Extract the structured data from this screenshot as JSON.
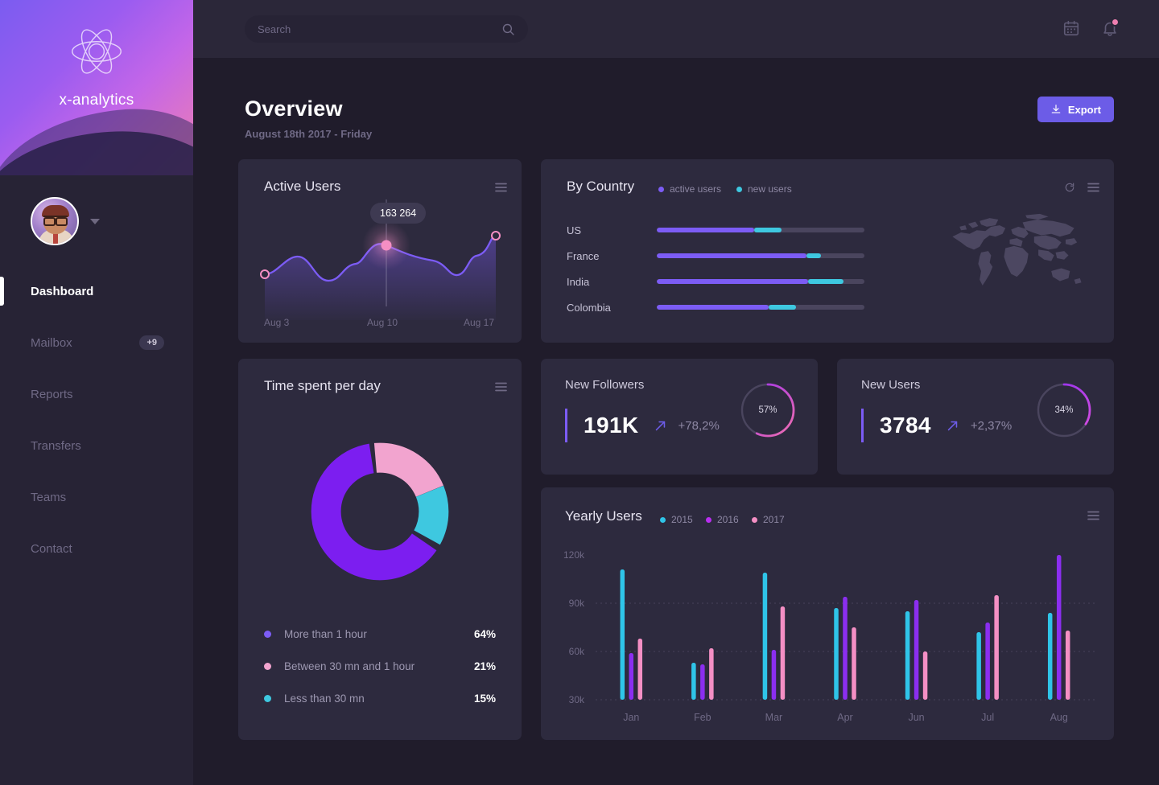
{
  "brand": {
    "name": "x-analytics",
    "logo_icon": "atom-icon"
  },
  "sidebar": {
    "avatar_icon": "avatar",
    "caret_icon": "chevron-down-icon",
    "items": [
      {
        "label": "Dashboard",
        "active": true,
        "badge": ""
      },
      {
        "label": "Mailbox",
        "active": false,
        "badge": "+9"
      },
      {
        "label": "Reports",
        "active": false,
        "badge": ""
      },
      {
        "label": "Transfers",
        "active": false,
        "badge": ""
      },
      {
        "label": "Teams",
        "active": false,
        "badge": ""
      },
      {
        "label": "Contact",
        "active": false,
        "badge": ""
      }
    ]
  },
  "topbar": {
    "search_placeholder": "Search",
    "search_value": "",
    "search_icon": "search-icon",
    "calendar_icon": "calendar-icon",
    "bell_icon": "bell-icon",
    "has_notification": true
  },
  "header": {
    "title": "Overview",
    "subtitle": "August  18th  2017 - Friday",
    "export_label": "Export",
    "export_icon": "download-icon",
    "accent": "#6c5ce7"
  },
  "active_users": {
    "title": "Active Users",
    "menu_icon": "hamburger-icon",
    "tooltip": "163 264",
    "axis": [
      "Aug 3",
      "Aug 10",
      "Aug 17"
    ]
  },
  "by_country": {
    "title": "By Country",
    "menu_icon": "hamburger-icon",
    "refresh_icon": "refresh-icon",
    "legend": [
      {
        "label": "active users",
        "color": "#7c5cf5"
      },
      {
        "label": "new users",
        "color": "#3ec8e0"
      }
    ],
    "rows": [
      {
        "country": "US",
        "active_pct": 47,
        "new_pct": 13
      },
      {
        "country": "France",
        "active_pct": 72,
        "new_pct": 7
      },
      {
        "country": "India",
        "active_pct": 73,
        "new_pct": 17
      },
      {
        "country": "Colombia",
        "active_pct": 54,
        "new_pct": 13
      }
    ]
  },
  "time_spent": {
    "title": "Time spent per day",
    "menu_icon": "hamburger-icon",
    "segments": [
      {
        "label": "More than 1 hour",
        "value": "64%",
        "pct": 64,
        "color": "#7c1ef0"
      },
      {
        "label": "Between 30 mn and 1 hour",
        "value": "21%",
        "pct": 21,
        "color": "#f2a4cf"
      },
      {
        "label": "Less than 30 mn",
        "value": "15%",
        "pct": 15,
        "color": "#3ec8e0"
      }
    ]
  },
  "new_followers": {
    "title": "New Followers",
    "value": "191K",
    "delta": "+78,2%",
    "arrow_icon": "arrow-up-right-icon",
    "ring_label": "57%",
    "ring_pct": 57
  },
  "new_users": {
    "title": "New Users",
    "value": "3784",
    "delta": "+2,37%",
    "arrow_icon": "arrow-up-right-icon",
    "ring_label": "34%",
    "ring_pct": 34
  },
  "yearly_users": {
    "title": "Yearly Users",
    "menu_icon": "hamburger-icon"
  },
  "chart_data": [
    {
      "type": "line",
      "title": "Active Users",
      "x": [
        "Aug 3",
        "Aug 10",
        "Aug 17"
      ],
      "highlight_point": {
        "x": "Aug 10",
        "label": "163 264"
      },
      "line_color": "#7c5cf5",
      "point_color": "#f58fc4",
      "xlabel": "",
      "ylabel": "",
      "grid": false
    },
    {
      "type": "bar",
      "title": "By Country",
      "orientation": "horizontal",
      "categories": [
        "US",
        "France",
        "India",
        "Colombia"
      ],
      "series": [
        {
          "name": "active users",
          "values": [
            47,
            72,
            73,
            54
          ],
          "color": "#7c5cf5"
        },
        {
          "name": "new users",
          "values": [
            13,
            7,
            17,
            13
          ],
          "color": "#3ec8e0"
        }
      ],
      "xlim": [
        0,
        100
      ],
      "ylabel": "",
      "xlabel": "",
      "legend": "top"
    },
    {
      "type": "pie",
      "title": "Time spent per day",
      "labels": [
        "More than 1 hour",
        "Between 30 mn and 1 hour",
        "Less than 30 mn"
      ],
      "values": [
        64,
        21,
        15
      ],
      "colors": [
        "#7c1ef0",
        "#f2a4cf",
        "#3ec8e0"
      ],
      "donut": true,
      "legend": "bottom"
    },
    {
      "type": "bar",
      "title": "New Followers gauge",
      "values": [
        57
      ],
      "labels": [
        "57%"
      ],
      "ylim": [
        0,
        100
      ]
    },
    {
      "type": "bar",
      "title": "New Users gauge",
      "values": [
        34
      ],
      "labels": [
        "34%"
      ],
      "ylim": [
        0,
        100
      ]
    },
    {
      "type": "bar",
      "title": "Yearly Users",
      "categories": [
        "Jan",
        "Feb",
        "Mar",
        "Apr",
        "Jun",
        "Jul",
        "Aug"
      ],
      "series": [
        {
          "name": "2015",
          "color": "#2fc4e8",
          "values": [
            111,
            53,
            109,
            87,
            85,
            72,
            84
          ]
        },
        {
          "name": "2016",
          "color": "#8b2ef0",
          "values": [
            59,
            52,
            61,
            94,
            92,
            78,
            120
          ]
        },
        {
          "name": "2017",
          "color": "#f48fc4",
          "values": [
            68,
            62,
            88,
            75,
            60,
            95,
            73
          ]
        }
      ],
      "ylim": [
        30,
        120
      ],
      "yticks": [
        30,
        60,
        90,
        120
      ],
      "yticklabels": [
        "30k",
        "60k",
        "90k",
        "120k"
      ],
      "xlabel": "",
      "ylabel": "",
      "grid": true,
      "legend": "top"
    }
  ]
}
